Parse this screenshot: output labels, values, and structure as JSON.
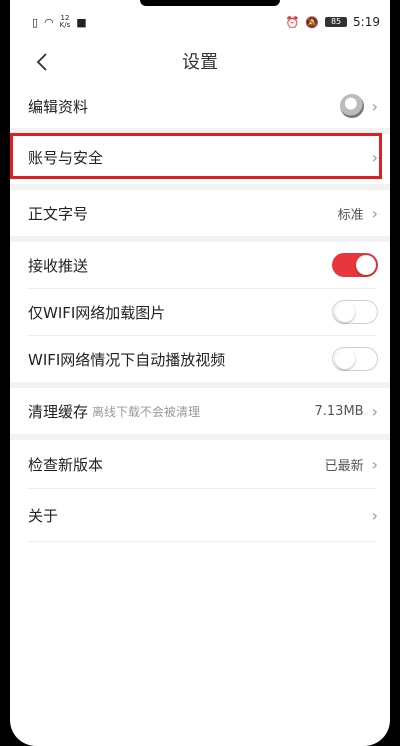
{
  "status_bar": {
    "network_speed_value": "12",
    "network_speed_unit": "K/s",
    "battery": "85",
    "time": "5:19"
  },
  "header": {
    "title": "设置"
  },
  "rows": {
    "edit_profile": "编辑资料",
    "account_security": "账号与安全",
    "font_size": "正文字号",
    "font_size_value": "标准",
    "receive_push": "接收推送",
    "wifi_images": "仅WIFI网络加载图片",
    "wifi_autoplay": "WIFI网络情况下自动播放视频",
    "clear_cache": "清理缓存",
    "clear_cache_note": "离线下载不会被清理",
    "cache_size": "7.13MB",
    "check_update": "检查新版本",
    "check_update_value": "已最新",
    "about": "关于"
  },
  "toggles": {
    "receive_push": true,
    "wifi_images": false,
    "wifi_autoplay": false
  },
  "colors": {
    "accent": "#e8363d",
    "highlight_border": "#e02020"
  },
  "icons": {
    "back": "chevron-left-icon",
    "chevron": "chevron-right-icon"
  }
}
